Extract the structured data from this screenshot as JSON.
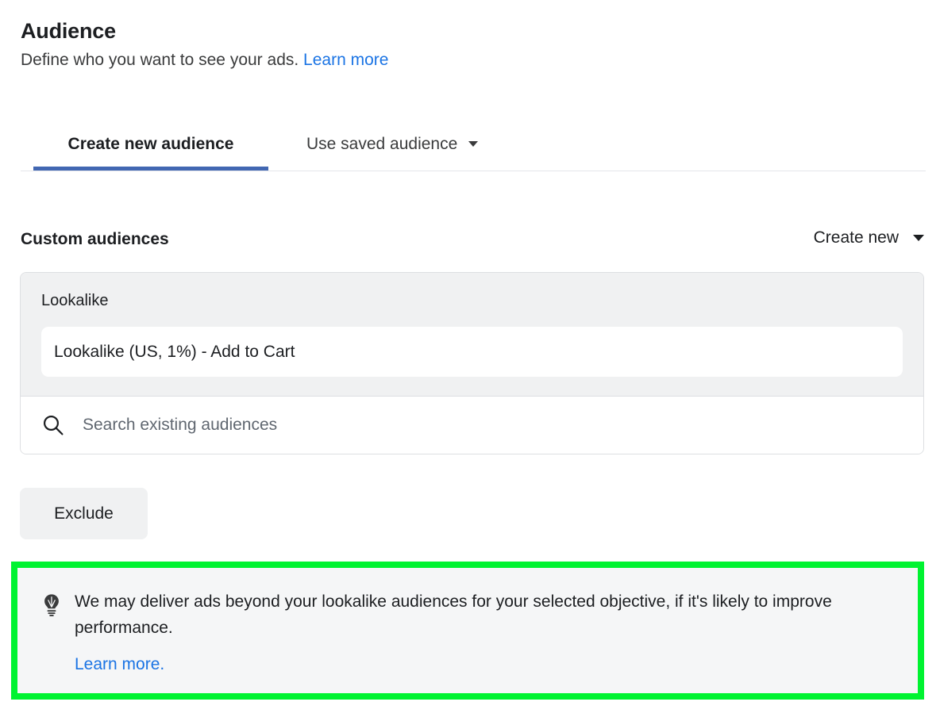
{
  "header": {
    "title": "Audience",
    "subtitle": "Define who you want to see your ads.",
    "learn_more_label": "Learn more"
  },
  "tabs": [
    {
      "label": "Create new audience",
      "active": true
    },
    {
      "label": "Use saved audience",
      "active": false,
      "has_caret": true
    }
  ],
  "custom_audiences": {
    "section_title": "Custom audiences",
    "create_new_label": "Create new",
    "group_label": "Lookalike",
    "selected_chip": "Lookalike (US, 1%) - Add to Cart",
    "search_placeholder": "Search existing audiences",
    "search_value": "",
    "search_icon": "search-icon"
  },
  "exclude_button_label": "Exclude",
  "tip": {
    "icon": "lightbulb-icon",
    "text": "We may deliver ads beyond your lookalike audiences for your selected objective, if it's likely to improve performance.",
    "learn_more_label": "Learn more.",
    "highlight_color": "#00f331"
  },
  "colors": {
    "link_blue": "#1b74e4",
    "tab_underline_blue": "#4267b2",
    "card_gray": "#f0f1f2",
    "tip_bg": "#f5f6f7",
    "highlight_green": "#00f331"
  }
}
